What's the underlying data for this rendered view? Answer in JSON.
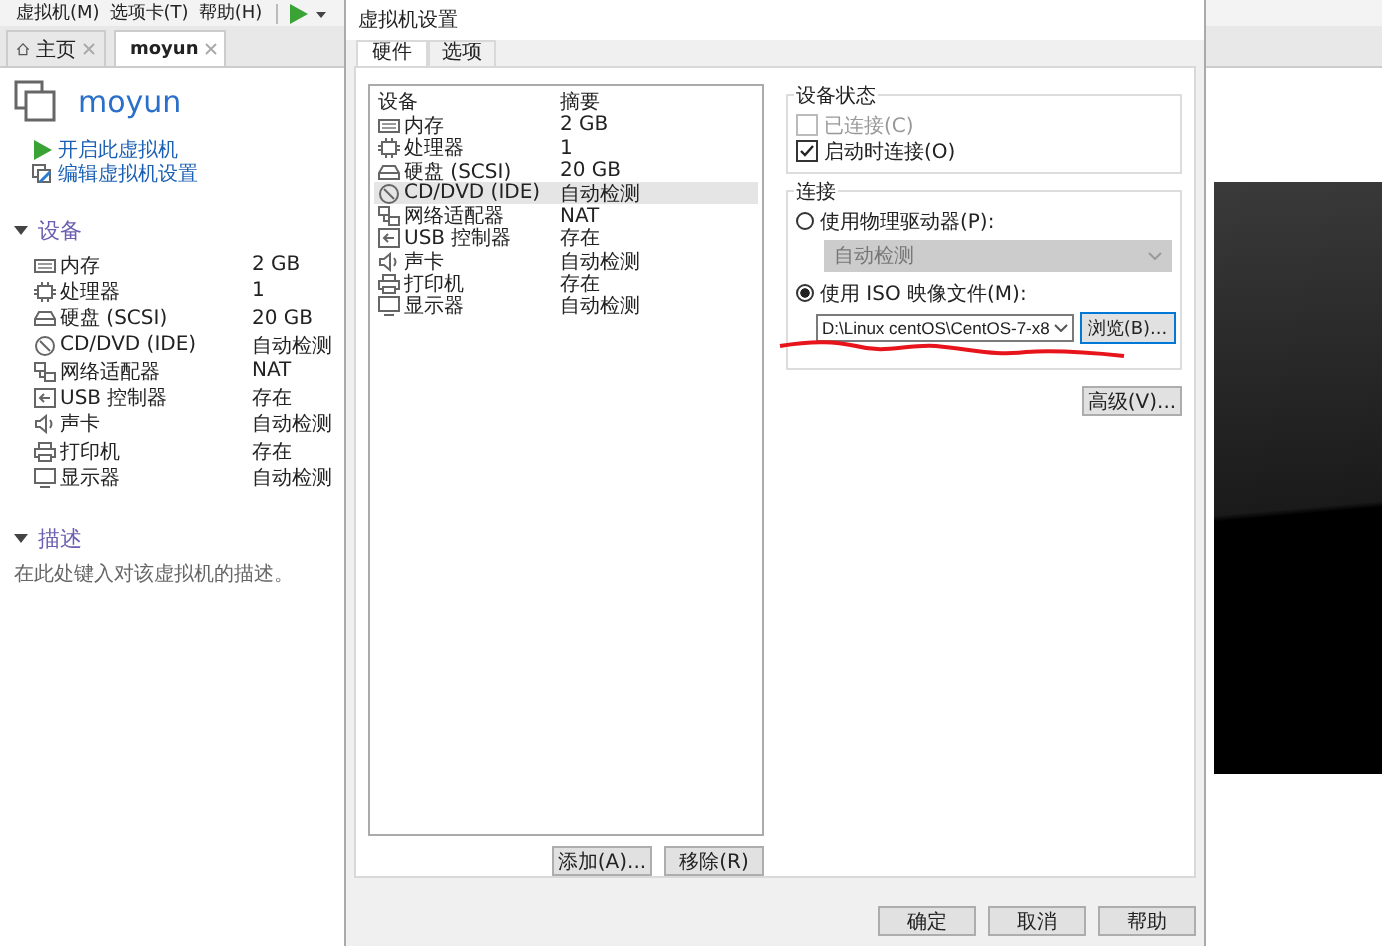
{
  "menu_bar": [
    "虚拟机(M)",
    "选项卡(T)",
    "帮助(H)"
  ],
  "tabs": [
    {
      "label": "主页",
      "kind": "home",
      "selected": false
    },
    {
      "label": "moyun",
      "kind": "vm",
      "selected": true
    }
  ],
  "vm": {
    "name": "moyun",
    "actions": [
      {
        "label": "开启此虚拟机",
        "kind": "play"
      },
      {
        "label": "编辑虚拟机设置",
        "kind": "edit"
      }
    ],
    "devices_heading": "设备",
    "devices": [
      {
        "name": "内存",
        "value": "2 GB",
        "kind": "memory"
      },
      {
        "name": "处理器",
        "value": "1",
        "kind": "cpu"
      },
      {
        "name": "硬盘 (SCSI)",
        "value": "20 GB",
        "kind": "disk"
      },
      {
        "name": "CD/DVD (IDE)",
        "value": "自动检测",
        "kind": "cd"
      },
      {
        "name": "网络适配器",
        "value": "NAT",
        "kind": "network"
      },
      {
        "name": "USB 控制器",
        "value": "存在",
        "kind": "usb"
      },
      {
        "name": "声卡",
        "value": "自动检测",
        "kind": "sound"
      },
      {
        "name": "打印机",
        "value": "存在",
        "kind": "printer"
      },
      {
        "name": "显示器",
        "value": "自动检测",
        "kind": "display"
      }
    ],
    "description_heading": "描述",
    "description_placeholder": "在此处键入对该虚拟机的描述。"
  },
  "dialog": {
    "title": "虚拟机设置",
    "tabs": [
      {
        "label": "硬件",
        "selected": true
      },
      {
        "label": "选项",
        "selected": false
      }
    ],
    "columns": [
      "设备",
      "摘要"
    ],
    "devices": [
      {
        "name": "内存",
        "value": "2 GB",
        "kind": "memory",
        "selected": false
      },
      {
        "name": "处理器",
        "value": "1",
        "kind": "cpu",
        "selected": false
      },
      {
        "name": "硬盘 (SCSI)",
        "value": "20 GB",
        "kind": "disk",
        "selected": false
      },
      {
        "name": "CD/DVD (IDE)",
        "value": "自动检测",
        "kind": "cd",
        "selected": true
      },
      {
        "name": "网络适配器",
        "value": "NAT",
        "kind": "network",
        "selected": false
      },
      {
        "name": "USB 控制器",
        "value": "存在",
        "kind": "usb",
        "selected": false
      },
      {
        "name": "声卡",
        "value": "自动检测",
        "kind": "sound",
        "selected": false
      },
      {
        "name": "打印机",
        "value": "存在",
        "kind": "printer",
        "selected": false
      },
      {
        "name": "显示器",
        "value": "自动检测",
        "kind": "display",
        "selected": false
      }
    ],
    "list_buttons": [
      "添加(A)...",
      "移除(R)"
    ],
    "device_status": {
      "title": "设备状态",
      "options": [
        {
          "label": "已连接(C)",
          "checked": false,
          "disabled": true
        },
        {
          "label": "启动时连接(O)",
          "checked": true,
          "disabled": false
        }
      ]
    },
    "connection": {
      "title": "连接",
      "sources": [
        {
          "kind": "drive",
          "label": "使用物理驱动器(P):",
          "selected": false,
          "value": "自动检测",
          "disabled": true
        },
        {
          "kind": "iso",
          "label": "使用 ISO 映像文件(M):",
          "selected": true,
          "value": "D:\\Linux centOS\\CentOS-7-x8",
          "button": "浏览(B)...",
          "underlined": true
        }
      ]
    },
    "advanced_button": "高级(V)...",
    "footer_buttons": [
      "确定",
      "取消",
      "帮助"
    ]
  }
}
